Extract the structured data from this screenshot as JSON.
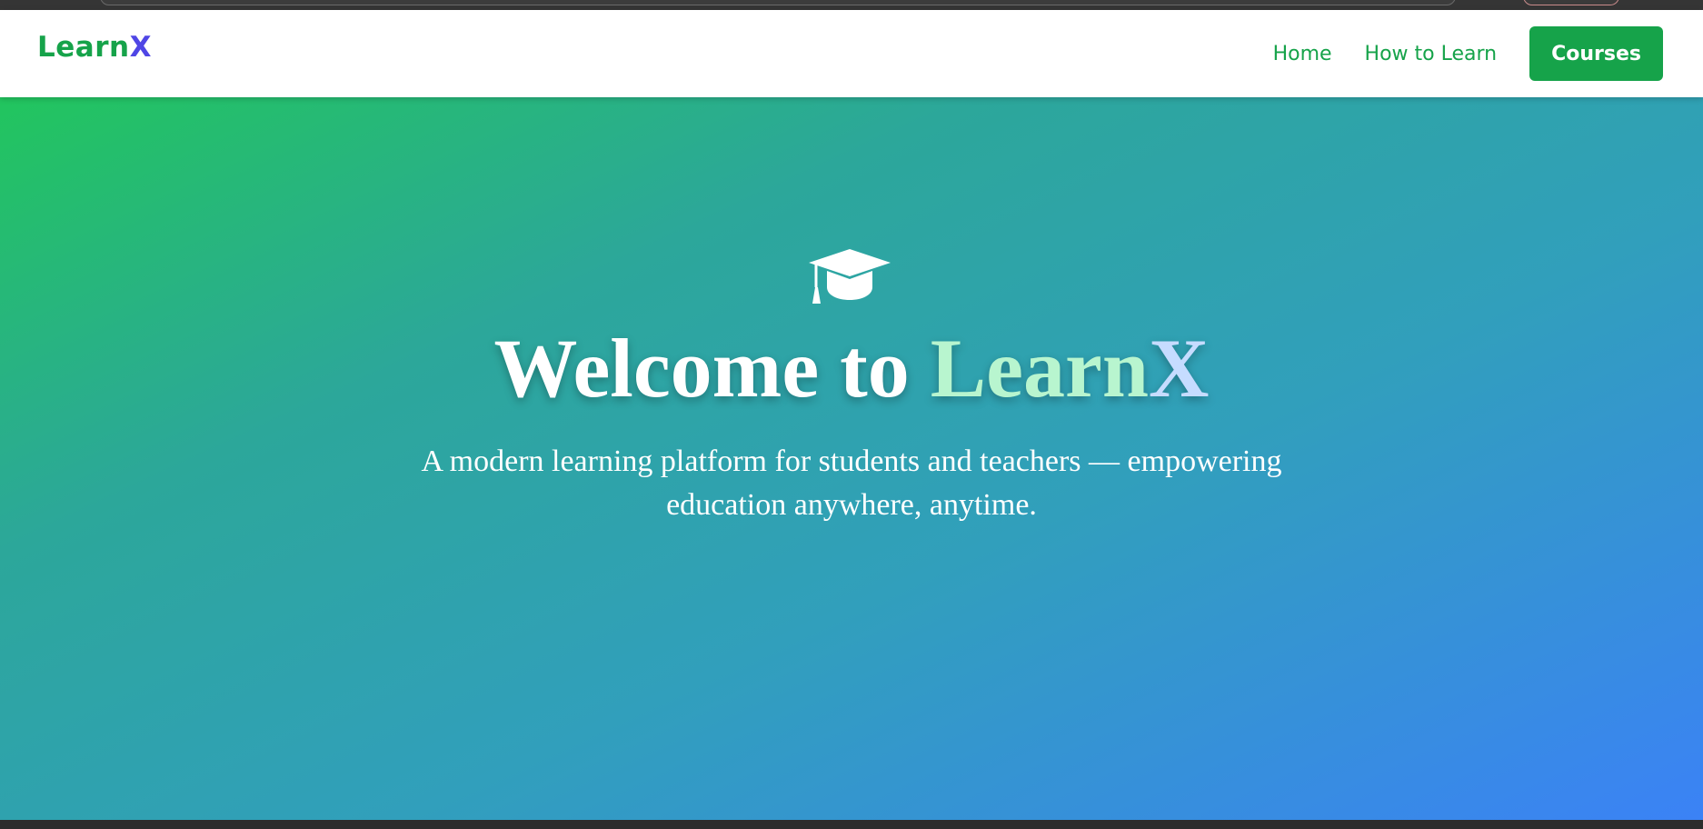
{
  "brand": {
    "name_part1": "Learn",
    "name_part2": "X",
    "primary_color": "#16a34a",
    "accent_color": "#4f46e5"
  },
  "nav": {
    "items": [
      {
        "label": "Home"
      },
      {
        "label": "How to Learn"
      }
    ],
    "cta_label": "Courses"
  },
  "hero": {
    "icon": "graduation-cap-icon",
    "title_part1": "Welcome to ",
    "title_part2": "Learn",
    "title_part3": "X",
    "subtitle": "A modern learning platform for students and teachers — empowering education anywhere, anytime.",
    "gradient_start": "#22c55e",
    "gradient_end": "#3b82f6"
  }
}
